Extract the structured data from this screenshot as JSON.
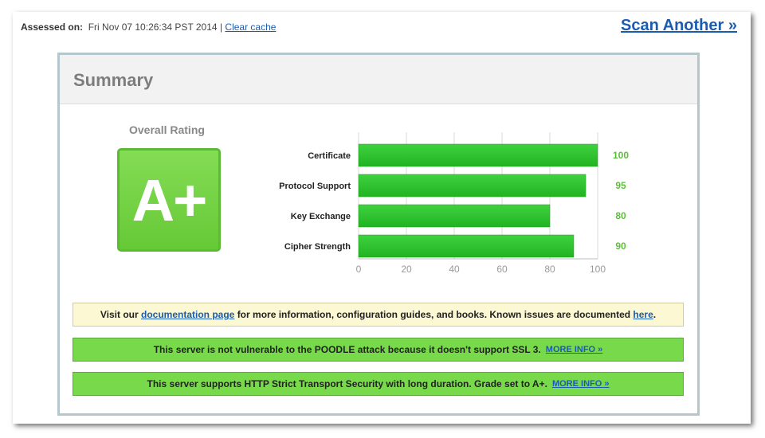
{
  "header": {
    "assessed_label": "Assessed on:",
    "assessed_value": "Fri Nov 07 10:26:34 PST 2014",
    "separator": "|",
    "clear_cache": "Clear cache",
    "scan_another": "Scan Another »"
  },
  "summary": {
    "title": "Summary",
    "overall_rating_label": "Overall Rating",
    "grade": "A+"
  },
  "chart_data": {
    "type": "bar",
    "orientation": "horizontal",
    "categories": [
      "Certificate",
      "Protocol Support",
      "Key Exchange",
      "Cipher Strength"
    ],
    "values": [
      100,
      95,
      80,
      90
    ],
    "xlim": [
      0,
      100
    ],
    "xticks": [
      0,
      20,
      40,
      60,
      80,
      100
    ],
    "grid": true,
    "bar_color": "#22b322",
    "value_label_color": "#5cbf3b"
  },
  "notices": {
    "docs": {
      "pre": "Visit our",
      "link1": "documentation page",
      "mid": "for more information, configuration guides, and books. Known issues are documented",
      "link2": "here",
      "post": "."
    },
    "poodle": {
      "text": "This server is not vulnerable to the POODLE attack because it doesn't support SSL 3.",
      "more": "MORE INFO »"
    },
    "hsts": {
      "text": "This server supports HTTP Strict Transport Security with long duration. Grade set to A+.",
      "more": "MORE INFO »"
    }
  },
  "colors": {
    "link": "#1a5cb0",
    "grade_bg": "#6fd23e",
    "notice_green": "#78da4a",
    "notice_yellow": "#fcf8d4"
  }
}
